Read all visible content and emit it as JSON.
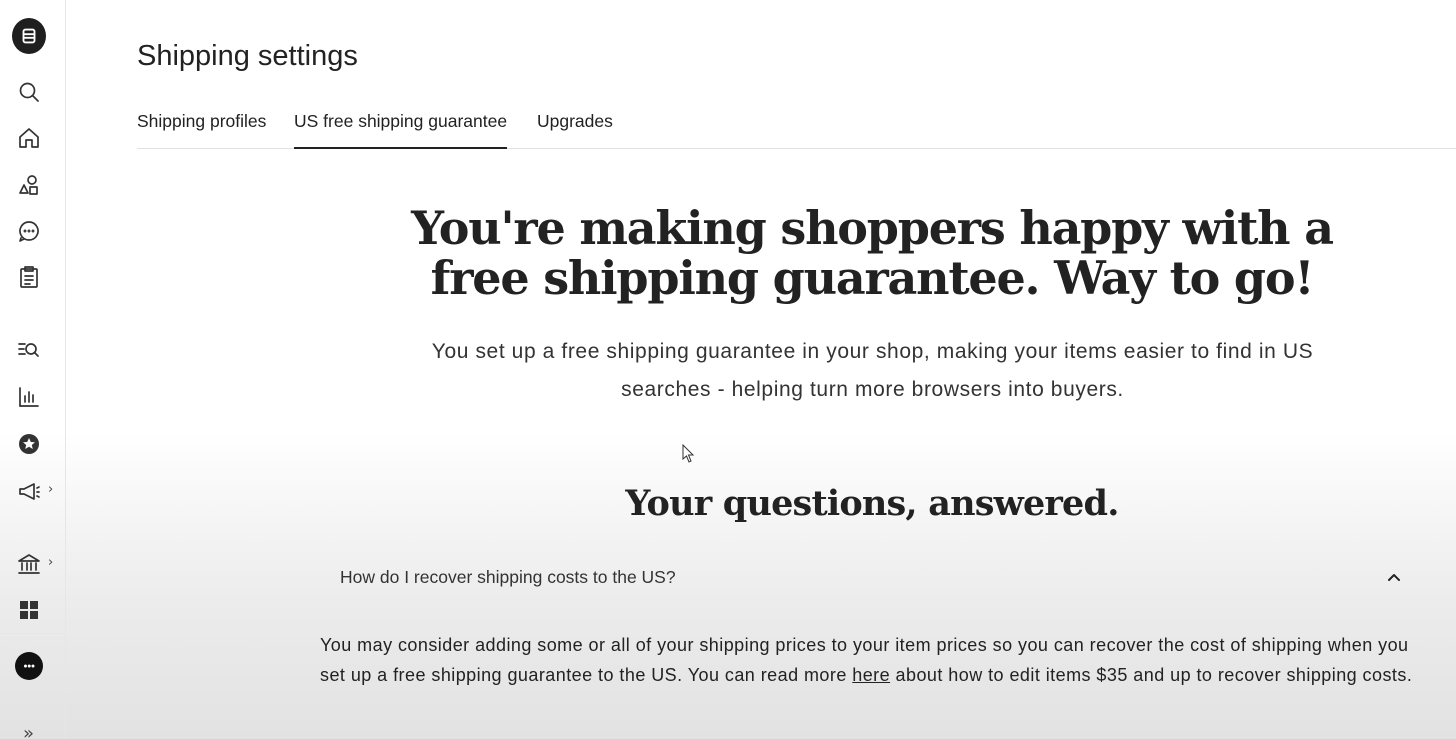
{
  "sidebar": {
    "items": [
      {
        "name": "search-icon"
      },
      {
        "name": "home-icon"
      },
      {
        "name": "shapes-icon"
      },
      {
        "name": "messages-icon"
      },
      {
        "name": "orders-clipboard-icon"
      },
      {
        "name": "search-stats-icon"
      },
      {
        "name": "stats-bar-icon"
      },
      {
        "name": "star-badge-icon"
      },
      {
        "name": "megaphone-icon",
        "has_submenu": true
      },
      {
        "name": "bank-icon",
        "has_submenu": true
      },
      {
        "name": "grid-icon"
      }
    ],
    "chevron_glyph": "›",
    "expand_glyph": "»"
  },
  "header": {
    "title": "Shipping settings",
    "tabs": [
      {
        "label": "Shipping profiles",
        "active": false
      },
      {
        "label": "US free shipping guarantee",
        "active": true
      },
      {
        "label": "Upgrades",
        "active": false
      }
    ]
  },
  "hero": {
    "title": "You're making shoppers happy with a free shipping guarantee. Way to go!",
    "subtitle": "You set up a free shipping guarantee in your shop, making your items easier to find in US searches - helping turn more browsers into buyers."
  },
  "faq": {
    "title": "Your questions, answered.",
    "items": [
      {
        "question": "How do I recover shipping costs to the US?",
        "expanded": true,
        "answer_before_link": "You may consider adding some or all of your shipping prices to your item prices so you can recover the cost of shipping when you set up a free shipping guarantee to the US. You can read more ",
        "answer_link": "here",
        "answer_after_link": " about how to edit items $35 and up to recover shipping costs."
      }
    ]
  },
  "colors": {
    "text": "#222222",
    "tab_underline": "#222222",
    "divider": "#e1e1e1"
  }
}
